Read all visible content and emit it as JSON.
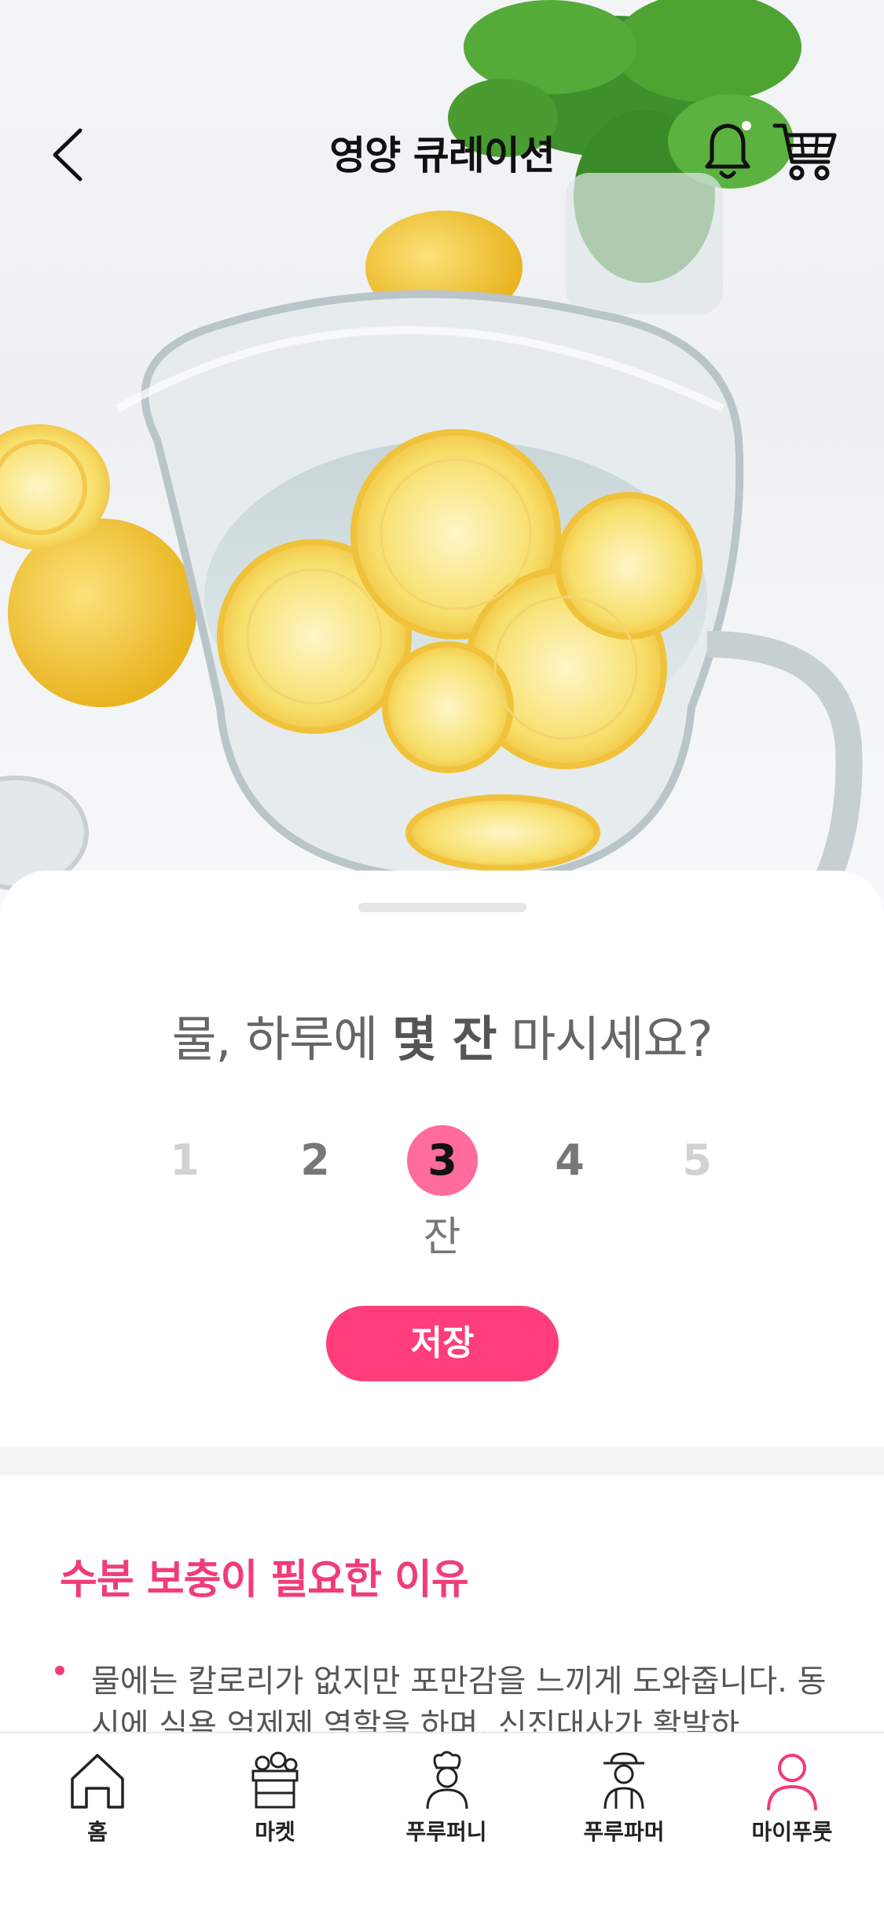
{
  "header": {
    "title": "영양 큐레이션"
  },
  "question": {
    "prefix": "물, 하루에 ",
    "emphasis": "몇 잔",
    "suffix": " 마시세요?"
  },
  "cups": {
    "options": [
      "1",
      "2",
      "3",
      "4",
      "5"
    ],
    "selected": "3",
    "unit": "잔"
  },
  "save_label": "저장",
  "reason": {
    "title": "수분 보충이 필요한 이유",
    "items": [
      "물에는 칼로리가 없지만 포만감을 느끼게 도와줍니다. 동시에 식욕 억제제 역할을 하며, 신진대사가 활발하"
    ]
  },
  "tabbar": {
    "items": [
      {
        "label": "홈",
        "icon": "house-icon"
      },
      {
        "label": "마켓",
        "icon": "market-basket-icon"
      },
      {
        "label": "푸루퍼니",
        "icon": "chef-icon"
      },
      {
        "label": "푸루파머",
        "icon": "farmer-icon"
      },
      {
        "label": "마이푸룻",
        "icon": "person-icon"
      }
    ],
    "active": "마이푸룻"
  },
  "colors": {
    "accent": "#ff3d7a",
    "selected_circle": "#ff6b9b",
    "section_title": "#f03c79",
    "active_tab": "#f03c79"
  }
}
